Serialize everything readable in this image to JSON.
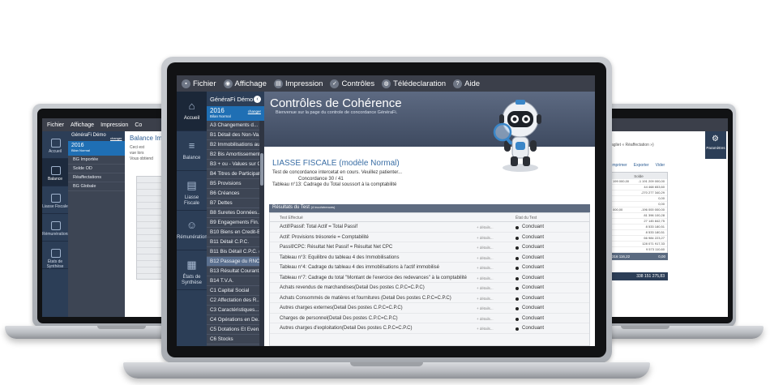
{
  "left": {
    "menu": [
      "Fichier",
      "Affichage",
      "Impression",
      "Co"
    ],
    "sidebar": [
      "Accueil",
      "Balance",
      "Liasse Fiscale",
      "Rémunérations",
      "États de Synthèse"
    ],
    "nav_header": "GénéraFi Démo",
    "year": "2016",
    "year_sub": "Bilan Normal",
    "year_link": "changer",
    "nav_items": [
      "BG Importée",
      "Solde OD",
      "Réaffectations",
      "BG Globale"
    ],
    "title": "Balance Impo",
    "text": [
      "Ceci est",
      "vue lors",
      "Vous obtiend"
    ]
  },
  "right": {
    "gear_label": "Paramètres",
    "label": "agliet « Réaffectation »)",
    "tools": [
      "Imprimer",
      "Exporter",
      "Vider"
    ],
    "col_head": "Solde",
    "rows": [
      [
        "199 000,00",
        "-1 191 209 000,00"
      ],
      [
        "",
        "44 468 653,60"
      ],
      [
        "",
        "-270 277 340,29"
      ],
      [
        "",
        "0,00"
      ],
      [
        "",
        "0,00"
      ],
      [
        "000,00",
        "-196 000 000,00"
      ],
      [
        "",
        "81 396 100,28"
      ],
      [
        "",
        "27 145 842,75"
      ],
      [
        "",
        "8 533 180,51"
      ],
      [
        "",
        "8 533 180,51"
      ],
      [
        "",
        "66 984 223,27"
      ],
      [
        "",
        "128 071 917,33"
      ],
      [
        "",
        "9 573 110,60"
      ],
      [
        "",
        "14 486 000,00"
      ],
      [
        "",
        "12 457 142,08"
      ]
    ],
    "total_left": "316 116,22",
    "total_right": "0,00",
    "grand_total": "338 151 275,83"
  },
  "center": {
    "menu": [
      {
        "label": "Fichier",
        "icon": "folder-icon"
      },
      {
        "label": "Affichage",
        "icon": "eye-icon"
      },
      {
        "label": "Impression",
        "icon": "printer-icon"
      },
      {
        "label": "Contrôles",
        "icon": "check-icon"
      },
      {
        "label": "Télédeclaration",
        "icon": "globe-icon"
      },
      {
        "label": "Aide",
        "icon": "help-icon"
      }
    ],
    "sidebar": [
      {
        "label": "Accueil",
        "glyph": "⌂",
        "icon": "home-icon",
        "active": true
      },
      {
        "label": "Balance",
        "glyph": "≡",
        "icon": "list-icon",
        "active": false
      },
      {
        "label": "Liasse Fiscale",
        "glyph": "▤",
        "icon": "document-icon",
        "active": false
      },
      {
        "label": "Rémunérations",
        "glyph": "☺",
        "icon": "person-icon",
        "active": false
      },
      {
        "label": "États de Synthèse",
        "glyph": "▦",
        "icon": "grid-icon",
        "active": false
      }
    ],
    "nav_header": "GénéraFi Démo",
    "year": "2016",
    "year_sub": "Bilan Normal",
    "year_link": "changer",
    "nav_items": [
      "A3 Changements d...",
      "B1 Détail des Non-Va...",
      "B2 Immobilisations au...",
      "B2 Bis Amortissements",
      "B3 + ou - Values sur C...",
      "B4 Titres de Participat...",
      "B5 Provisions",
      "B6 Créances",
      "B7 Dettes",
      "B8 Suretes Données...",
      "B9 Engagements Fin...",
      "B10 Biens en Credit-Bail",
      "B11 Détail C.P.C.",
      "B11 Bis Détail C.P.C. (s...",
      "B12 Passage du RNC...",
      "B13 Résultat Courant...",
      "B14 T.V.A.",
      "C1 Capital Social",
      "C2 Affectation des R...",
      "C3 Caractéristiques...",
      "C4 Opérations en De...",
      "C5 Dotations Et Even...",
      "C6 Stocks"
    ],
    "selected_index": 14,
    "banner_title": "Contrôles de Cohérence",
    "banner_sub": "Bienvenue sur la page du controle de concordance GénéraFi.",
    "liasse_title": "LIASSE FISCALE (modèle Normal)",
    "info": [
      "Test de concordance intercetat en cours. Veuillez patienter...",
      "Concordance 30 / 41",
      "Tableau n°13: Cadrage du Total soussort à la comptabilité"
    ],
    "results_title": "Résultats du Test",
    "results_sub": "(4 incohérences)",
    "col_test": "Test Effectué",
    "col_state": "État du Test",
    "details_label": "+ détails...",
    "rows": [
      {
        "label": "Actif/Passif: Total Actif = Total Passif",
        "status": "Concluant"
      },
      {
        "label": "Actif: Provisions trésorerie = Comptabilité",
        "status": "Concluant"
      },
      {
        "label": "Passif/CPC: Résultat Net Passif = Résultat Net CPC",
        "status": "Concluant"
      },
      {
        "label": "Tableau n°3: Equilibre du tableau 4 des Immobilisations",
        "status": "Concluant"
      },
      {
        "label": "Tableau n°4: Cadrage du tableau 4 des immobilisations à l'actif immobilisé",
        "status": "Concluant"
      },
      {
        "label": "Tableau n°7: Cadrage du total \"Montant de l'exercice des redevances\" à la comptabilité",
        "status": "Concluant"
      },
      {
        "label": "Achats revendus de marchandises(Detail Des postes C.P.C=C.P.C)",
        "status": "Concluant"
      },
      {
        "label": "Achats Consommés de matières et fournitures (Detail Des postes C.P.C=C.P.C)",
        "status": "Concluant"
      },
      {
        "label": "Autres charges externes(Detail Des postes C.P.C=C.P.C)",
        "status": "Concluant"
      },
      {
        "label": "Charges de personnel(Detail Des postes C.P.C=C.P.C)",
        "status": "Concluant"
      },
      {
        "label": "Autres charges d'exploitation(Detail Des postes C.P.C=C.P.C)",
        "status": "Concluant"
      }
    ]
  }
}
